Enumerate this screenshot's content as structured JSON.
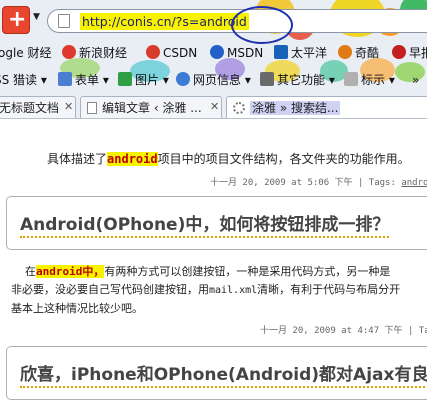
{
  "address_bar": {
    "url": "http://conis.cn/?s=android"
  },
  "bookmarks_row1": [
    {
      "label": "ogle 财经",
      "icon": "finance-icon",
      "color": "#2a7de1"
    },
    {
      "label": "新浪财经",
      "icon": "sina-icon",
      "color": "#e03a2f"
    },
    {
      "label": "CSDN",
      "icon": "csdn-icon",
      "color": "#d83b2b"
    },
    {
      "label": "MSDN",
      "icon": "msdn-icon",
      "color": "#2460c9"
    },
    {
      "label": "太平洋",
      "icon": "pconline-icon",
      "color": "#1a62b8"
    },
    {
      "label": "奇酷",
      "icon": "qiku-icon",
      "color": "#e07a12"
    },
    {
      "label": "早报",
      "icon": "zaobao-icon",
      "color": "#c31f1f"
    }
  ],
  "bookmarks_row2": [
    {
      "label": "SS 猎读 ▾",
      "icon": "",
      "color": "#ff8a00"
    },
    {
      "label": "表单 ▾",
      "icon": "form-icon",
      "color": "#4c7ed1"
    },
    {
      "label": "图片 ▾",
      "icon": "image-icon",
      "color": "#2f9e44"
    },
    {
      "label": "网页信息 ▾",
      "icon": "info-icon",
      "color": "#3b7bd4"
    },
    {
      "label": "其它功能 ▾",
      "icon": "tools-icon",
      "color": "#6a6a6a"
    },
    {
      "label": "标示 ▾",
      "icon": "mark-icon",
      "color": "#b0b0b0"
    }
  ],
  "tabs": [
    {
      "label": "无标题文档"
    },
    {
      "label": "编辑文章 ‹ 涂雅 ..."
    },
    {
      "label": "涂雅 » 搜索结..."
    }
  ],
  "content": {
    "p1": {
      "pre": "具体描述了",
      "keyword": "android",
      "post": "项目中的项目文件结构，各文件夹的功能作用。"
    },
    "meta1": {
      "date": "十一月 20, 2009 at 5:06 下午",
      "sep": " | Tags: ",
      "tag": "android,"
    },
    "post1_title": "Android(OPhone)中，如何将按钮排成一排？",
    "p2": {
      "pre": "在",
      "keyword": "android",
      "kw_suffix": "中，",
      "line1_rest": "有两种方式可以创建按钮，一种是采用代码方式，另一种是",
      "line2_pre": "非必要，没必要自己写代码创建按钮，用",
      "line2_mono": "mail.xml",
      "line2_post": "清晰，有利于代码与布局分开",
      "line3": "基本上这种情况比较少吧。"
    },
    "meta2": {
      "date": "十一月 20, 2009 at 4:47 下午",
      "sep": " | Tags:"
    },
    "post2_title": "欣喜，iPhone和OPhone(Android)都对Ajax有良好"
  }
}
